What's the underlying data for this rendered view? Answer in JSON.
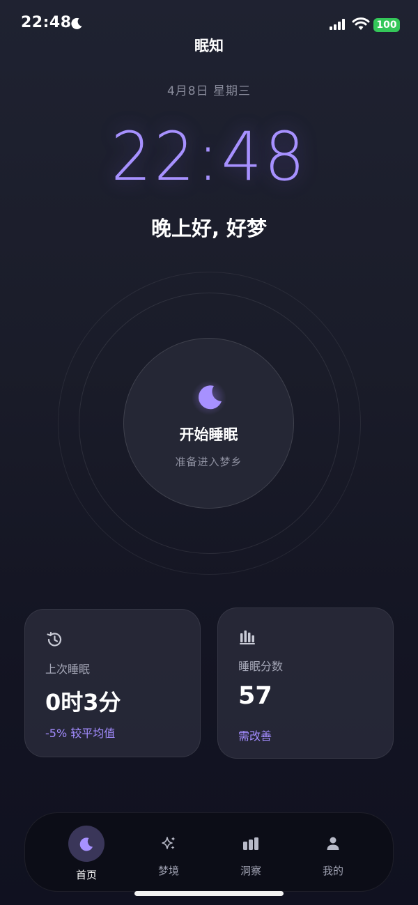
{
  "status_bar": {
    "time": "22:48",
    "battery": "100",
    "icons": [
      "moon-icon",
      "signal-icon",
      "wifi-icon",
      "battery-icon"
    ]
  },
  "header": {
    "title": "眠知"
  },
  "main": {
    "date": "4月8日 星期三",
    "clock": "22:48",
    "greeting": "晚上好, 好梦",
    "sleep_button": {
      "label": "开始睡眠",
      "subtitle": "准备进入梦乡",
      "icon": "moon-icon"
    }
  },
  "cards": {
    "last_sleep": {
      "icon": "history-icon",
      "label": "上次睡眠",
      "value": "0时3分",
      "note": "-5% 较平均值"
    },
    "sleep_score": {
      "icon": "bar-chart-icon",
      "label": "睡眠分数",
      "value": "57",
      "note": "需改善"
    }
  },
  "tab_bar": {
    "tabs": [
      {
        "label": "首页",
        "icon": "moon-icon",
        "active": true
      },
      {
        "label": "梦境",
        "icon": "sparkles-icon",
        "active": false
      },
      {
        "label": "洞察",
        "icon": "bar-chart-icon",
        "active": false
      },
      {
        "label": "我的",
        "icon": "person-icon",
        "active": false
      }
    ]
  },
  "colors": {
    "accent": "#a791ff",
    "accent_note": "#a38cff",
    "battery": "#34c759",
    "background": "#1a1c29"
  }
}
